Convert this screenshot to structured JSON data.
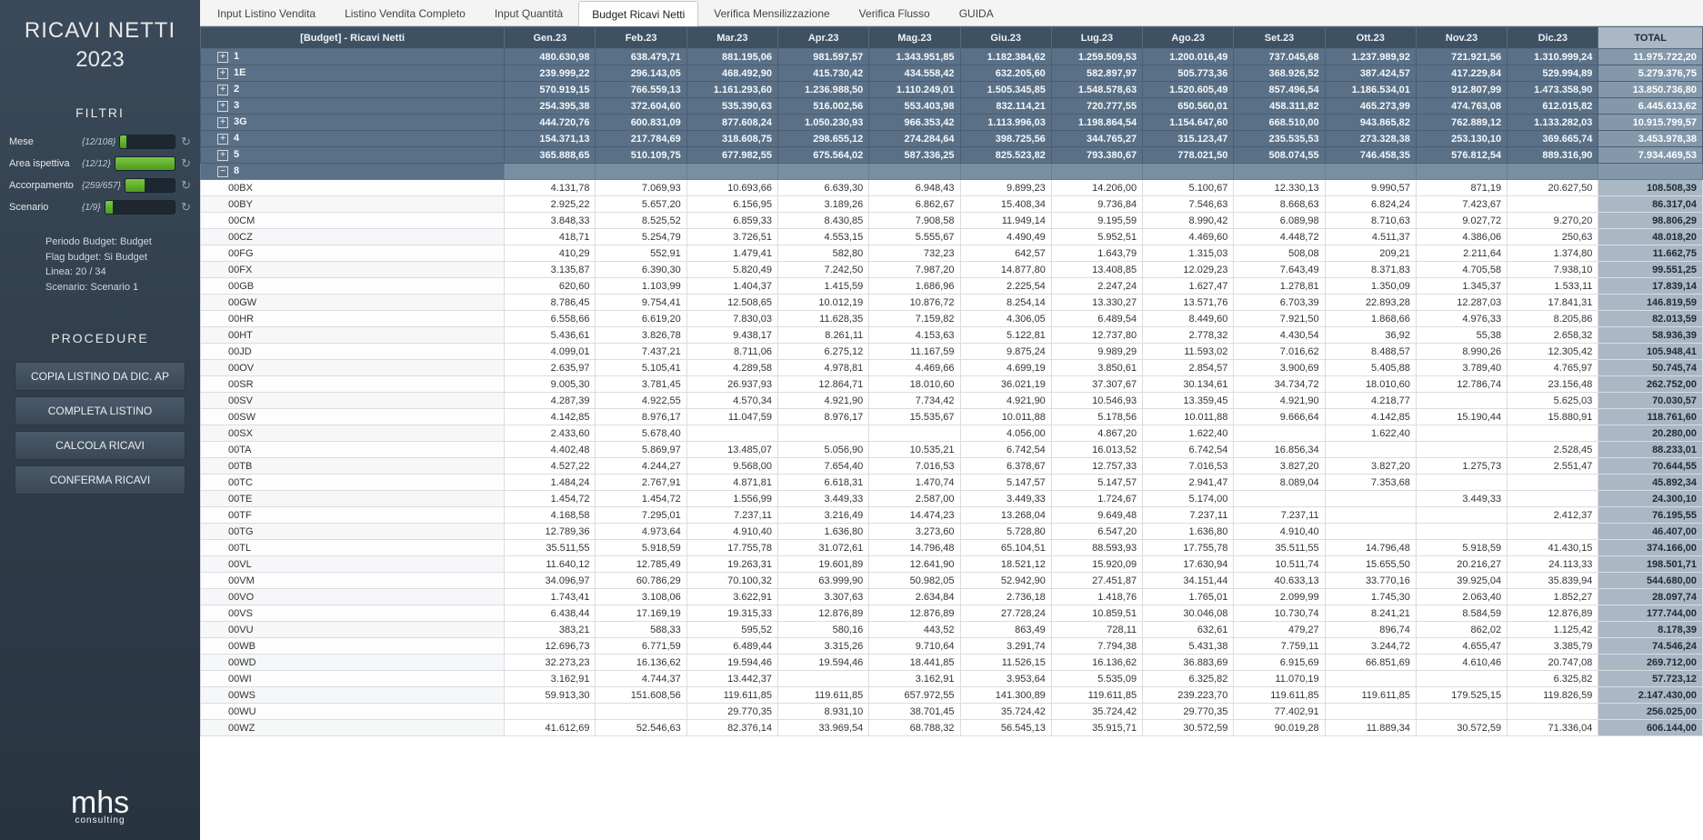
{
  "sidebar": {
    "title": "RICAVI NETTI",
    "year": "2023",
    "filters_header": "FILTRI",
    "filters": [
      {
        "label": "Mese",
        "count": "{12/108}",
        "pct": 11
      },
      {
        "label": "Area ispettiva",
        "count": "{12/12}",
        "pct": 100
      },
      {
        "label": "Accorpamento",
        "count": "{259/657}",
        "pct": 39
      },
      {
        "label": "Scenario",
        "count": "{1/9}",
        "pct": 11
      }
    ],
    "info": [
      "Periodo Budget: Budget",
      "Flag budget: Si Budget",
      "Linea: 20 / 34",
      "Scenario: Scenario 1"
    ],
    "proc_header": "PROCEDURE",
    "buttons": [
      "COPIA LISTINO DA DIC. AP",
      "COMPLETA LISTINO",
      "CALCOLA RICAVI",
      "CONFERMA RICAVI"
    ],
    "logo": "mhs",
    "logo_sub": "consulting"
  },
  "tabs": [
    {
      "label": "Input Listino Vendita"
    },
    {
      "label": "Listino Vendita Completo"
    },
    {
      "label": "Input Quantità"
    },
    {
      "label": "Budget Ricavi Netti",
      "active": true
    },
    {
      "label": "Verifica Mensilizzazione"
    },
    {
      "label": "Verifica Flusso"
    },
    {
      "label": "GUIDA"
    }
  ],
  "grid": {
    "row_header": "[Budget] - Ricavi Netti",
    "months": [
      "Gen.23",
      "Feb.23",
      "Mar.23",
      "Apr.23",
      "Mag.23",
      "Giu.23",
      "Lug.23",
      "Ago.23",
      "Set.23",
      "Ott.23",
      "Nov.23",
      "Dic.23"
    ],
    "total_label": "TOTAL",
    "groups": [
      {
        "code": "1",
        "v": [
          "480.630,98",
          "638.479,71",
          "881.195,06",
          "981.597,57",
          "1.343.951,85",
          "1.182.384,62",
          "1.259.509,53",
          "1.200.016,49",
          "737.045,68",
          "1.237.989,92",
          "721.921,56",
          "1.310.999,24"
        ],
        "t": "11.975.722,20"
      },
      {
        "code": "1E",
        "v": [
          "239.999,22",
          "296.143,05",
          "468.492,90",
          "415.730,42",
          "434.558,42",
          "632.205,60",
          "582.897,97",
          "505.773,36",
          "368.926,52",
          "387.424,57",
          "417.229,84",
          "529.994,89"
        ],
        "t": "5.279.376,75"
      },
      {
        "code": "2",
        "v": [
          "570.919,15",
          "766.559,13",
          "1.161.293,60",
          "1.236.988,50",
          "1.110.249,01",
          "1.505.345,85",
          "1.548.578,63",
          "1.520.605,49",
          "857.496,54",
          "1.186.534,01",
          "912.807,99",
          "1.473.358,90"
        ],
        "t": "13.850.736,80"
      },
      {
        "code": "3",
        "v": [
          "254.395,38",
          "372.604,60",
          "535.390,63",
          "516.002,56",
          "553.403,98",
          "832.114,21",
          "720.777,55",
          "650.560,01",
          "458.311,82",
          "465.273,99",
          "474.763,08",
          "612.015,82"
        ],
        "t": "6.445.613,62"
      },
      {
        "code": "3G",
        "v": [
          "444.720,76",
          "600.831,09",
          "877.608,24",
          "1.050.230,93",
          "966.353,42",
          "1.113.996,03",
          "1.198.864,54",
          "1.154.647,60",
          "668.510,00",
          "943.865,82",
          "762.889,12",
          "1.133.282,03"
        ],
        "t": "10.915.799,57"
      },
      {
        "code": "4",
        "v": [
          "154.371,13",
          "217.784,69",
          "318.608,75",
          "298.655,12",
          "274.284,64",
          "398.725,56",
          "344.765,27",
          "315.123,47",
          "235.535,53",
          "273.328,38",
          "253.130,10",
          "369.665,74"
        ],
        "t": "3.453.978,38"
      },
      {
        "code": "5",
        "v": [
          "365.888,65",
          "510.109,75",
          "677.982,55",
          "675.564,02",
          "587.336,25",
          "825.523,82",
          "793.380,67",
          "778.021,50",
          "508.074,55",
          "746.458,35",
          "576.812,54",
          "889.316,90"
        ],
        "t": "7.934.469,53"
      }
    ],
    "open_group": {
      "code": "8"
    },
    "rows": [
      {
        "c": "00BX",
        "v": [
          "4.131,78",
          "7.069,93",
          "10.693,66",
          "6.639,30",
          "6.948,43",
          "9.899,23",
          "14.206,00",
          "5.100,67",
          "12.330,13",
          "9.990,57",
          "871,19",
          "20.627,50"
        ],
        "t": "108.508,39"
      },
      {
        "c": "00BY",
        "v": [
          "2.925,22",
          "5.657,20",
          "6.156,95",
          "3.189,26",
          "6.862,67",
          "15.408,34",
          "9.736,84",
          "7.546,63",
          "8.668,63",
          "6.824,24",
          "7.423,67",
          ""
        ],
        "t": "86.317,04"
      },
      {
        "c": "00CM",
        "v": [
          "3.848,33",
          "8.525,52",
          "6.859,33",
          "8.430,85",
          "7.908,58",
          "11.949,14",
          "9.195,59",
          "8.990,42",
          "6.089,98",
          "8.710,63",
          "9.027,72",
          "9.270,20"
        ],
        "t": "98.806,29"
      },
      {
        "c": "00CZ",
        "v": [
          "418,71",
          "5.254,79",
          "3.726,51",
          "4.553,15",
          "5.555,67",
          "4.490,49",
          "5.952,51",
          "4.469,60",
          "4.448,72",
          "4.511,37",
          "4.386,06",
          "250,63"
        ],
        "t": "48.018,20"
      },
      {
        "c": "00FG",
        "v": [
          "410,29",
          "552,91",
          "1.479,41",
          "582,80",
          "732,23",
          "642,57",
          "1.643,79",
          "1.315,03",
          "508,08",
          "209,21",
          "2.211,64",
          "1.374,80"
        ],
        "t": "11.662,75"
      },
      {
        "c": "00FX",
        "v": [
          "3.135,87",
          "6.390,30",
          "5.820,49",
          "7.242,50",
          "7.987,20",
          "14.877,80",
          "13.408,85",
          "12.029,23",
          "7.643,49",
          "8.371,83",
          "4.705,58",
          "7.938,10"
        ],
        "t": "99.551,25"
      },
      {
        "c": "00GB",
        "v": [
          "620,60",
          "1.103,99",
          "1.404,37",
          "1.415,59",
          "1.686,96",
          "2.225,54",
          "2.247,24",
          "1.627,47",
          "1.278,81",
          "1.350,09",
          "1.345,37",
          "1.533,11"
        ],
        "t": "17.839,14"
      },
      {
        "c": "00GW",
        "v": [
          "8.786,45",
          "9.754,41",
          "12.508,65",
          "10.012,19",
          "10.876,72",
          "8.254,14",
          "13.330,27",
          "13.571,76",
          "6.703,39",
          "22.893,28",
          "12.287,03",
          "17.841,31"
        ],
        "t": "146.819,59"
      },
      {
        "c": "00HR",
        "v": [
          "6.558,66",
          "6.619,20",
          "7.830,03",
          "11.628,35",
          "7.159,82",
          "4.306,05",
          "6.489,54",
          "8.449,60",
          "7.921,50",
          "1.868,66",
          "4.976,33",
          "8.205,86"
        ],
        "t": "82.013,59"
      },
      {
        "c": "00HT",
        "v": [
          "5.436,61",
          "3.826,78",
          "9.438,17",
          "8.261,11",
          "4.153,63",
          "5.122,81",
          "12.737,80",
          "2.778,32",
          "4.430,54",
          "36,92",
          "55,38",
          "2.658,32"
        ],
        "t": "58.936,39"
      },
      {
        "c": "00JD",
        "v": [
          "4.099,01",
          "7.437,21",
          "8.711,06",
          "6.275,12",
          "11.167,59",
          "9.875,24",
          "9.989,29",
          "11.593,02",
          "7.016,62",
          "8.488,57",
          "8.990,26",
          "12.305,42"
        ],
        "t": "105.948,41"
      },
      {
        "c": "00OV",
        "v": [
          "2.635,97",
          "5.105,41",
          "4.289,58",
          "4.978,81",
          "4.469,66",
          "4.699,19",
          "3.850,61",
          "2.854,57",
          "3.900,69",
          "5.405,88",
          "3.789,40",
          "4.765,97"
        ],
        "t": "50.745,74"
      },
      {
        "c": "00SR",
        "v": [
          "9.005,30",
          "3.781,45",
          "26.937,93",
          "12.864,71",
          "18.010,60",
          "36.021,19",
          "37.307,67",
          "30.134,61",
          "34.734,72",
          "18.010,60",
          "12.786,74",
          "23.156,48"
        ],
        "t": "262.752,00"
      },
      {
        "c": "00SV",
        "v": [
          "4.287,39",
          "4.922,55",
          "4.570,34",
          "4.921,90",
          "7.734,42",
          "4.921,90",
          "10.546,93",
          "13.359,45",
          "4.921,90",
          "4.218,77",
          "",
          "5.625,03"
        ],
        "t": "70.030,57"
      },
      {
        "c": "00SW",
        "v": [
          "4.142,85",
          "8.976,17",
          "11.047,59",
          "8.976,17",
          "15.535,67",
          "10.011,88",
          "5.178,56",
          "10.011,88",
          "9.666,64",
          "4.142,85",
          "15.190,44",
          "15.880,91"
        ],
        "t": "118.761,60"
      },
      {
        "c": "00SX",
        "v": [
          "2.433,60",
          "5.678,40",
          "",
          "",
          "",
          "4.056,00",
          "4.867,20",
          "1.622,40",
          "",
          "1.622,40",
          "",
          ""
        ],
        "t": "20.280,00"
      },
      {
        "c": "00TA",
        "v": [
          "4.402,48",
          "5.869,97",
          "13.485,07",
          "5.056,90",
          "10.535,21",
          "6.742,54",
          "16.013,52",
          "6.742,54",
          "16.856,34",
          "",
          "",
          "2.528,45"
        ],
        "t": "88.233,01"
      },
      {
        "c": "00TB",
        "v": [
          "4.527,22",
          "4.244,27",
          "9.568,00",
          "7.654,40",
          "7.016,53",
          "6.378,67",
          "12.757,33",
          "7.016,53",
          "3.827,20",
          "3.827,20",
          "1.275,73",
          "2.551,47"
        ],
        "t": "70.644,55"
      },
      {
        "c": "00TC",
        "v": [
          "1.484,24",
          "2.767,91",
          "4.871,81",
          "6.618,31",
          "1.470,74",
          "5.147,57",
          "5.147,57",
          "2.941,47",
          "8.089,04",
          "7.353,68",
          "",
          ""
        ],
        "t": "45.892,34"
      },
      {
        "c": "00TE",
        "v": [
          "1.454,72",
          "1.454,72",
          "1.556,99",
          "3.449,33",
          "2.587,00",
          "3.449,33",
          "1.724,67",
          "5.174,00",
          "",
          "",
          "3.449,33",
          ""
        ],
        "t": "24.300,10"
      },
      {
        "c": "00TF",
        "v": [
          "4.168,58",
          "7.295,01",
          "7.237,11",
          "3.216,49",
          "14.474,23",
          "13.268,04",
          "9.649,48",
          "7.237,11",
          "7.237,11",
          "",
          "",
          "2.412,37"
        ],
        "t": "76.195,55"
      },
      {
        "c": "00TG",
        "v": [
          "12.789,36",
          "4.973,64",
          "4.910,40",
          "1.636,80",
          "3.273,60",
          "5.728,80",
          "6.547,20",
          "1.636,80",
          "4.910,40",
          "",
          "",
          ""
        ],
        "t": "46.407,00"
      },
      {
        "c": "00TL",
        "v": [
          "35.511,55",
          "5.918,59",
          "17.755,78",
          "31.072,61",
          "14.796,48",
          "65.104,51",
          "88.593,93",
          "17.755,78",
          "35.511,55",
          "14.796,48",
          "5.918,59",
          "41.430,15"
        ],
        "t": "374.166,00"
      },
      {
        "c": "00VL",
        "v": [
          "11.640,12",
          "12.785,49",
          "19.263,31",
          "19.601,89",
          "12.641,90",
          "18.521,12",
          "15.920,09",
          "17.630,94",
          "10.511,74",
          "15.655,50",
          "20.216,27",
          "24.113,33"
        ],
        "t": "198.501,71"
      },
      {
        "c": "00VM",
        "v": [
          "34.096,97",
          "60.786,29",
          "70.100,32",
          "63.999,90",
          "50.982,05",
          "52.942,90",
          "27.451,87",
          "34.151,44",
          "40.633,13",
          "33.770,16",
          "39.925,04",
          "35.839,94"
        ],
        "t": "544.680,00"
      },
      {
        "c": "00VO",
        "v": [
          "1.743,41",
          "3.108,06",
          "3.622,91",
          "3.307,63",
          "2.634,84",
          "2.736,18",
          "1.418,76",
          "1.765,01",
          "2.099,99",
          "1.745,30",
          "2.063,40",
          "1.852,27"
        ],
        "t": "28.097,74"
      },
      {
        "c": "00VS",
        "v": [
          "6.438,44",
          "17.169,19",
          "19.315,33",
          "12.876,89",
          "12.876,89",
          "27.728,24",
          "10.859,51",
          "30.046,08",
          "10.730,74",
          "8.241,21",
          "8.584,59",
          "12.876,89"
        ],
        "t": "177.744,00"
      },
      {
        "c": "00VU",
        "v": [
          "383,21",
          "588,33",
          "595,52",
          "580,16",
          "443,52",
          "863,49",
          "728,11",
          "632,61",
          "479,27",
          "896,74",
          "862,02",
          "1.125,42"
        ],
        "t": "8.178,39"
      },
      {
        "c": "00WB",
        "v": [
          "12.696,73",
          "6.771,59",
          "6.489,44",
          "3.315,26",
          "9.710,64",
          "3.291,74",
          "7.794,38",
          "5.431,38",
          "7.759,11",
          "3.244,72",
          "4.655,47",
          "3.385,79"
        ],
        "t": "74.546,24"
      },
      {
        "c": "00WD",
        "v": [
          "32.273,23",
          "16.136,62",
          "19.594,46",
          "19.594,46",
          "18.441,85",
          "11.526,15",
          "16.136,62",
          "36.883,69",
          "6.915,69",
          "66.851,69",
          "4.610,46",
          "20.747,08"
        ],
        "t": "269.712,00"
      },
      {
        "c": "00WI",
        "v": [
          "3.162,91",
          "4.744,37",
          "13.442,37",
          "",
          "3.162,91",
          "3.953,64",
          "5.535,09",
          "6.325,82",
          "11.070,19",
          "",
          "",
          "6.325,82"
        ],
        "t": "57.723,12"
      },
      {
        "c": "00WS",
        "v": [
          "59.913,30",
          "151.608,56",
          "119.611,85",
          "119.611,85",
          "657.972,55",
          "141.300,89",
          "119.611,85",
          "239.223,70",
          "119.611,85",
          "119.611,85",
          "179.525,15",
          "119.826,59"
        ],
        "t": "2.147.430,00"
      },
      {
        "c": "00WU",
        "v": [
          "",
          "",
          "29.770,35",
          "8.931,10",
          "38.701,45",
          "35.724,42",
          "35.724,42",
          "29.770,35",
          "77.402,91",
          "",
          "",
          ""
        ],
        "t": "256.025,00"
      },
      {
        "c": "00WZ",
        "v": [
          "41.612,69",
          "52.546,63",
          "82.376,14",
          "33.969,54",
          "68.788,32",
          "56.545,13",
          "35.915,71",
          "30.572,59",
          "90.019,28",
          "11.889,34",
          "30.572,59",
          "71.336,04"
        ],
        "t": "606.144,00"
      }
    ]
  }
}
